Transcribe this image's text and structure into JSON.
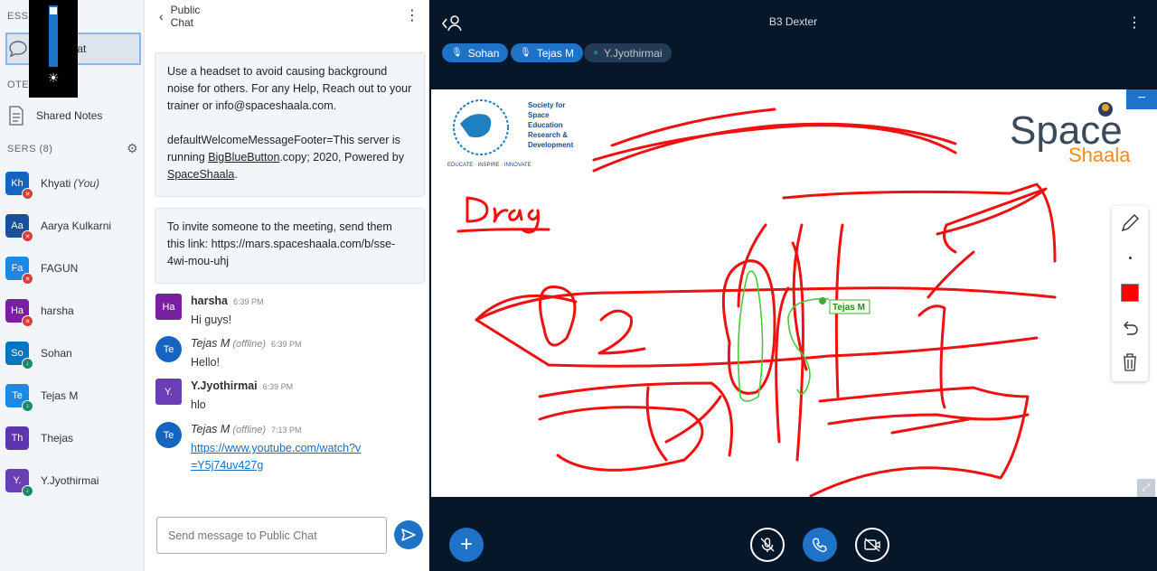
{
  "sidebar": {
    "messages_label": "ESSAG",
    "public_chat_label": "Chat",
    "notes_label": "OTES",
    "shared_notes_label": "Shared Notes",
    "users_label": "SERS (8)",
    "users": [
      {
        "initials": "Kh",
        "name": "Khyati",
        "suffix": "(You)",
        "color": "#1565c0",
        "badge": "muted"
      },
      {
        "initials": "Aa",
        "name": "Aarya Kulkarni",
        "suffix": "",
        "color": "#1a4f9c",
        "badge": "muted"
      },
      {
        "initials": "Fa",
        "name": "FAGUN",
        "suffix": "",
        "color": "#1e88e5",
        "badge": "muted"
      },
      {
        "initials": "Ha",
        "name": "harsha",
        "suffix": "",
        "color": "#7b1fa2",
        "badge": "muted"
      },
      {
        "initials": "So",
        "name": "Sohan",
        "suffix": "",
        "color": "#0277bd",
        "badge": "talk"
      },
      {
        "initials": "Te",
        "name": "Tejas M",
        "suffix": "",
        "color": "#1e88e5",
        "badge": "talk"
      },
      {
        "initials": "Th",
        "name": "Thejas",
        "suffix": "",
        "color": "#5e35b1",
        "badge": ""
      },
      {
        "initials": "Y.",
        "name": "Y.Jyothirmai",
        "suffix": "",
        "color": "#6a3fb5",
        "badge": "talk"
      }
    ]
  },
  "chat": {
    "title": "Public Chat",
    "welcome": {
      "line1": "Use a headset to avoid causing background noise for others. For any Help, Reach out to your trainer or info@spaceshaala.com.",
      "line2_prefix": "defaultWelcomeMessageFooter=This server is running ",
      "line2_link": "BigBlueButton",
      "line2_mid": ".copy; 2020, Powered by ",
      "line2_link2": "SpaceShaala",
      "line2_end": "."
    },
    "invite": "To invite someone to the meeting, send them this link: https://mars.spaceshaala.com/b/sse-4wi-mou-uhj",
    "messages": [
      {
        "initials": "Ha",
        "color": "#7b1fa2",
        "name": "harsha",
        "offline": "",
        "time": "6:39 PM",
        "text": "Hi guys!",
        "shape": "square"
      },
      {
        "initials": "Te",
        "color": "#1565c0",
        "name": "Tejas M",
        "offline": "(offline)",
        "time": "6:39 PM",
        "text": "Hello!",
        "shape": "circle"
      },
      {
        "initials": "Y.",
        "color": "#6a3fb5",
        "name": "Y.Jyothirmai",
        "offline": "",
        "time": "6:39 PM",
        "text": "hlo",
        "shape": "square"
      },
      {
        "initials": "Te",
        "color": "#1565c0",
        "name": "Tejas M",
        "offline": "(offline)",
        "time": "7:13 PM",
        "text": "https://www.youtube.com/watch?v=Y5j74uv427g",
        "shape": "circle"
      }
    ],
    "input_placeholder": "Send message to Public Chat"
  },
  "presentation": {
    "title": "B3 Dexter",
    "talkers": [
      {
        "name": "Sohan",
        "active": true
      },
      {
        "name": "Tejas M",
        "active": true
      },
      {
        "name": "Y.Jyothirmai",
        "active": false
      }
    ],
    "cursor_label": "Tejas M",
    "slide_logo_left": {
      "line1": "Society for",
      "line2": "Space",
      "line3": "Education",
      "line4": "Research &",
      "line5": "Development",
      "tagline": "EDUCATE · INSPIRE · INNOVATE"
    },
    "slide_logo_right": {
      "word1": "Space",
      "word2": "Shaala"
    },
    "draw_color": "#ff0000",
    "drag_text": "Drag"
  }
}
